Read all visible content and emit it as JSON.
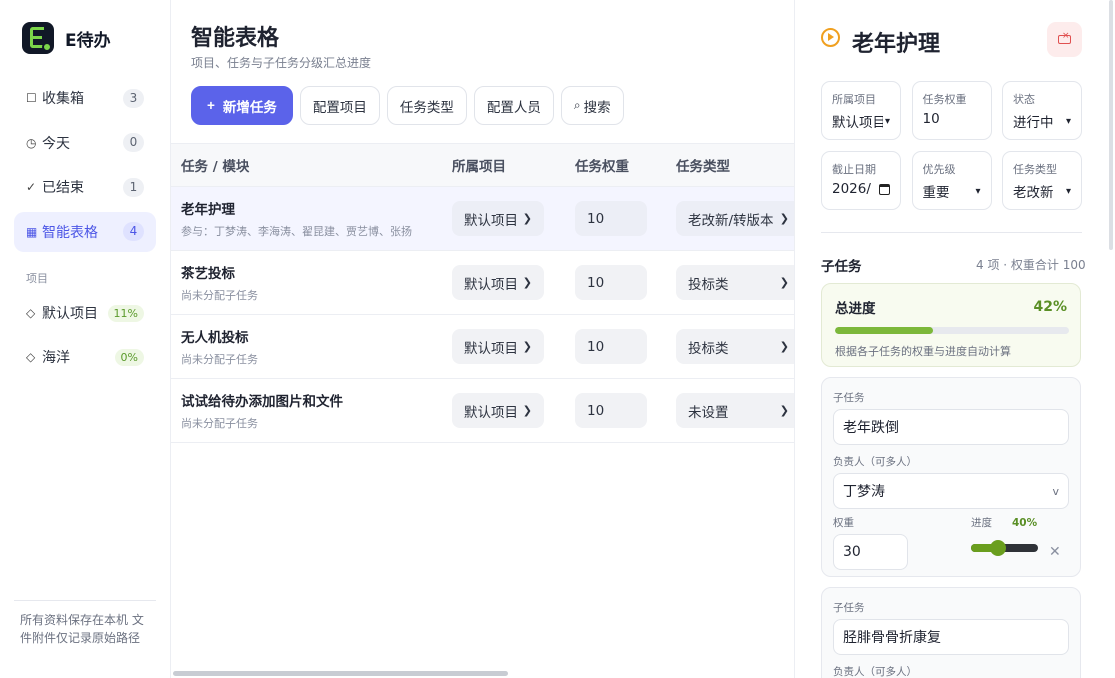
{
  "app": {
    "name": "E待办"
  },
  "sidebar": {
    "items": [
      {
        "icon": "inbox-icon",
        "glyph": "☐",
        "label": "收集箱",
        "count": "3"
      },
      {
        "icon": "clock-icon",
        "glyph": "◷",
        "label": "今天",
        "count": "0"
      },
      {
        "icon": "check-icon",
        "glyph": "✓",
        "label": "已结束",
        "count": "1"
      },
      {
        "icon": "grid-icon",
        "glyph": "▦",
        "label": "智能表格",
        "count": "4"
      }
    ],
    "section_title": "项目",
    "projects": [
      {
        "label": "默认项目",
        "badge": "11%"
      },
      {
        "label": "海洋",
        "badge": "0%"
      }
    ],
    "footer": "所有资料保存在本机 文件附件仅记录原始路径"
  },
  "main": {
    "title": "智能表格",
    "subtitle": "项目、任务与子任务分级汇总进度",
    "toolbar": {
      "add_label": "新增任务",
      "config_project": "配置项目",
      "task_types": "任务类型",
      "config_people": "配置人员",
      "search": "搜索"
    },
    "columns": [
      "任务 / 模块",
      "所属项目",
      "任务权重",
      "任务类型"
    ],
    "rows": [
      {
        "name": "老年护理",
        "sub": "参与：丁梦涛、李海涛、翟昆建、贾艺博、张扬",
        "project": "默认项目",
        "weight": "10",
        "type": "老改新/转版本"
      },
      {
        "name": "茶艺投标",
        "sub": "尚未分配子任务",
        "project": "默认项目",
        "weight": "10",
        "type": "投标类"
      },
      {
        "name": "无人机投标",
        "sub": "尚未分配子任务",
        "project": "默认项目",
        "weight": "10",
        "type": "投标类"
      },
      {
        "name": "试试给待办添加图片和文件",
        "sub": "尚未分配子任务",
        "project": "默认项目",
        "weight": "10",
        "type": "未设置"
      }
    ]
  },
  "panel": {
    "title": "老年护理",
    "fields": [
      {
        "label": "所属项目",
        "value": "默认项目"
      },
      {
        "label": "任务权重",
        "value": "10"
      },
      {
        "label": "状态",
        "value": "进行中"
      },
      {
        "label": "截止日期",
        "value": "2026/"
      },
      {
        "label": "优先级",
        "value": "重要"
      },
      {
        "label": "任务类型",
        "value": "老改新"
      }
    ],
    "subtasks_heading": "子任务",
    "subtasks_meta": "4 项 · 权重合计 100",
    "overall": {
      "label": "总进度",
      "value": "42%",
      "fraction": 0.42,
      "note": "根据各子任务的权重与进度自动计算"
    },
    "subtasks": [
      {
        "label": "子任务",
        "name": "老年跌倒",
        "assignee_label": "负责人（可多人）",
        "assignee": "丁梦涛",
        "weight_label": "权重",
        "weight": "30",
        "progress_label": "进度",
        "progress": "40%",
        "progress_fraction": 0.4
      },
      {
        "label": "子任务",
        "name": "胫腓骨骨折康复",
        "assignee_label": "负责人（可多人）"
      }
    ]
  },
  "colors": {
    "accent": "#5b63ea",
    "progress": "#7cb83a",
    "success_text": "#5a8f25"
  }
}
